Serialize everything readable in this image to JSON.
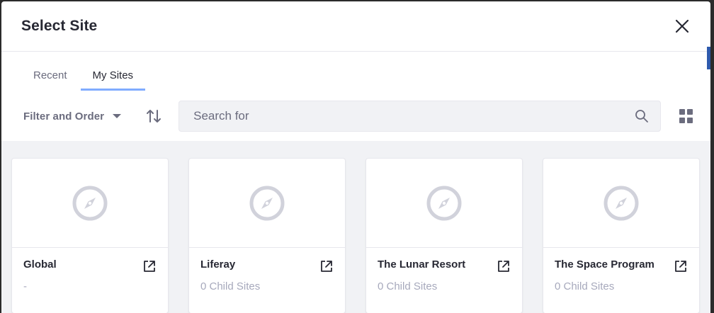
{
  "modal": {
    "title": "Select Site"
  },
  "tabs": [
    {
      "label": "Recent",
      "active": false
    },
    {
      "label": "My Sites",
      "active": true
    }
  ],
  "toolbar": {
    "filter_label": "Filter and Order",
    "search_placeholder": "Search for"
  },
  "sites": [
    {
      "name": "Global",
      "subtitle": "-"
    },
    {
      "name": "Liferay",
      "subtitle": "0 Child Sites"
    },
    {
      "name": "The Lunar Resort",
      "subtitle": "0 Child Sites"
    },
    {
      "name": "The Space Program",
      "subtitle": "0 Child Sites"
    }
  ],
  "icons": {
    "close": "close-icon",
    "sort": "sort-icon",
    "search": "search-icon",
    "view": "cards-view-icon",
    "site": "compass-icon",
    "external": "external-link-icon"
  },
  "colors": {
    "accent": "#80acff",
    "text": "#272833",
    "muted": "#6b6c7e",
    "background": "#f1f2f5"
  }
}
